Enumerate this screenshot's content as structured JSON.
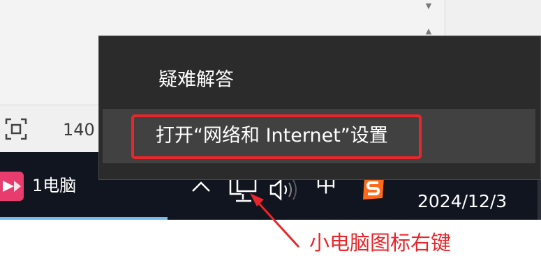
{
  "app": {
    "zoom_text": "140",
    "icons": [
      "chevron-down-icon",
      "chevron-up-icon",
      "fit-to-screen-icon"
    ]
  },
  "taskbar": {
    "app_label": "1电脑",
    "tray": {
      "input_method": "中",
      "icons": [
        "show-hidden-icons-chevron-icon",
        "network-computer-icon",
        "volume-icon",
        "sogou-input-icon"
      ]
    },
    "clock_date": "2024/12/3"
  },
  "context_menu": {
    "items": [
      {
        "label": "疑难解答"
      },
      {
        "label": "打开“网络和 Internet”设置"
      }
    ]
  },
  "annotation": {
    "text": "小电脑图标右键",
    "color": "#e8262b"
  },
  "colors": {
    "taskbar_bg": "#11151f",
    "menu_bg": "#2b2b2b",
    "menu_hover_bg": "#414141",
    "highlight": "#e8262b",
    "app_icon": "#e83b6e"
  }
}
